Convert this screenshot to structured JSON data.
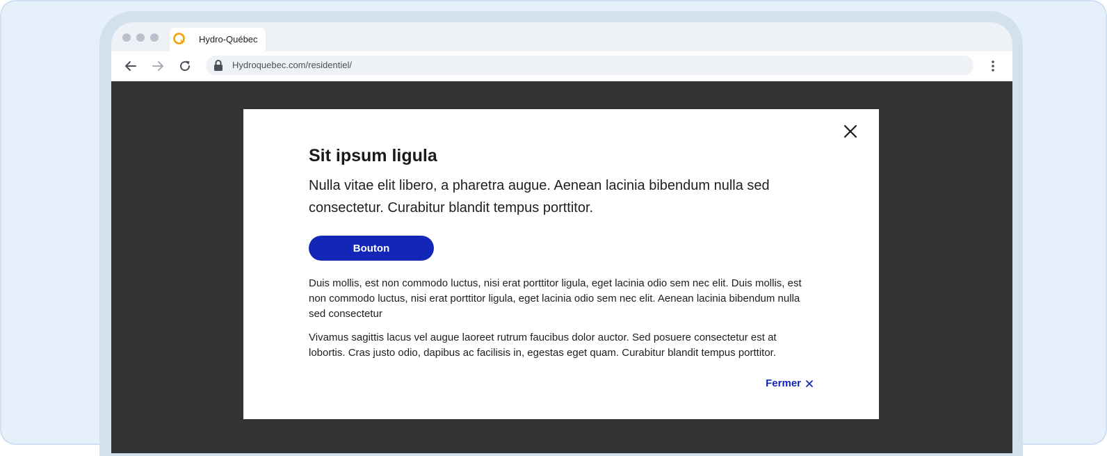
{
  "browser": {
    "tab_title": "Hydro-Québec",
    "url": "Hydroquebec.com/residentiel/"
  },
  "icons": {
    "tab_logo": "hydro-quebec-logo-icon",
    "back": "arrow-left-icon",
    "forward": "arrow-right-icon",
    "reload": "reload-icon",
    "lock": "lock-icon",
    "menu": "kebab-menu-icon",
    "close": "close-icon"
  },
  "modal": {
    "title": "Sit ipsum ligula",
    "lead": "Nulla vitae elit libero, a pharetra augue. Aenean lacinia bibendum nulla sed consectetur. Curabitur blandit tempus porttitor.",
    "button_label": "Bouton",
    "paragraphs": [
      "Duis mollis, est non commodo luctus, nisi erat porttitor ligula, eget lacinia odio sem nec elit. Duis mollis, est non commodo luctus, nisi erat porttitor ligula, eget lacinia odio sem nec elit. Aenean lacinia bibendum nulla sed consectetur",
      "Vivamus sagittis lacus vel augue laoreet rutrum faucibus dolor auctor. Sed posuere consectetur est at lobortis. Cras justo odio, dapibus ac facilisis in, egestas eget quam. Curabitur blandit tempus porttitor."
    ],
    "close_label": "Fermer"
  },
  "colors": {
    "brand_blue": "#1226b8",
    "logo_orange": "#f5a000",
    "overlay": "#333333",
    "frame_light": "#e6f0fb",
    "frame_device": "#d3e0ee"
  }
}
